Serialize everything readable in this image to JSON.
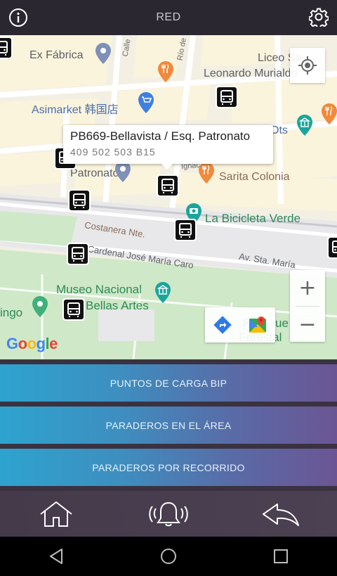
{
  "header": {
    "title": "RED",
    "info_icon": "info-icon",
    "settings_icon": "gear-icon"
  },
  "map": {
    "labels": {
      "ex_fabrica": "Ex Fábrica",
      "asimarket": "Asimarket 韩国店",
      "liceo": "Liceo Sa",
      "leonardo": "Leonardo Murialdo",
      "ots": "Ots",
      "patronato": "Patronato",
      "sarita": "Sarita Colonia",
      "bicicleta": "La Bicicleta Verde",
      "costanera": "Costanera Nte.",
      "cardenal": "Cardenal José María Caro",
      "av_sta_maria": "Av. Sta. María",
      "museo_1": "Museo Nacional",
      "museo_2": "Bellas Artes",
      "ingo": "ingo",
      "parque_1": "P",
      "parque_ue": "ue",
      "forestal": "Forestal",
      "calle": "Calle",
      "rio_de": "Río de",
      "ignac": "Ignac"
    },
    "tooltip": {
      "title": "PB669-Bellavista / Esq. Patronato",
      "routes": "409  502  503  B15"
    },
    "zoom_in": "+",
    "zoom_out": "−",
    "attribution": "Google"
  },
  "menu": {
    "btn1": "PUNTOS DE CARGA BIP",
    "btn2": "PARADEROS EN EL ÁREA",
    "btn3": "PARADEROS POR RECORRIDO"
  },
  "bottom_nav": [
    "home-icon",
    "bell-alert-icon",
    "back-arrow-icon"
  ],
  "colors": {
    "header_bg": "#2b2730",
    "panel_bg": "#3a3240",
    "button_gradient_start": "#2ea3cf",
    "button_gradient_end": "#6b5594"
  }
}
